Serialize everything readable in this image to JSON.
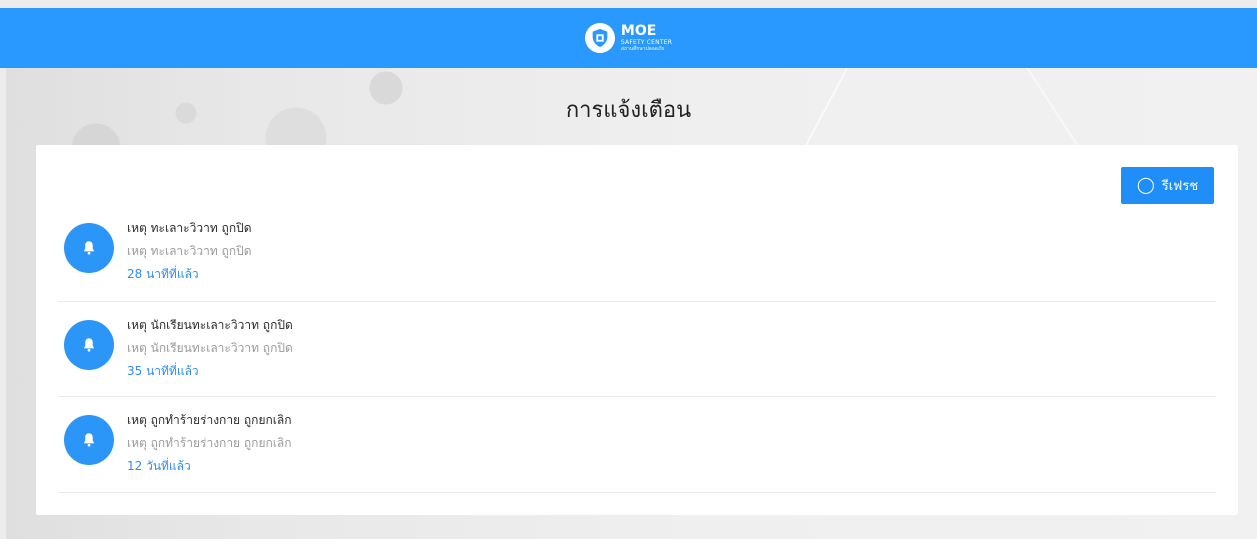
{
  "header": {
    "logo_title": "MOE",
    "logo_subtitle": "SAFETY CENTER",
    "logo_caption": "สถานศึกษาปลอดภัย"
  },
  "page": {
    "title": "การแจ้งเตือน"
  },
  "toolbar": {
    "refresh_label": "รีเฟรช"
  },
  "notifications": [
    {
      "title": "เหตุ ทะเลาะวิวาท ถูกปิด",
      "subtitle": "เหตุ ทะเลาะวิวาท ถูกปิด",
      "time": "28 นาทีที่แล้ว"
    },
    {
      "title": "เหตุ นักเรียนทะเลาะวิวาท ถูกปิด",
      "subtitle": "เหตุ นักเรียนทะเลาะวิวาท ถูกปิด",
      "time": "35 นาทีที่แล้ว"
    },
    {
      "title": "เหตุ ถูกทำร้ายร่างกาย ถูกยกเลิก",
      "subtitle": "เหตุ ถูกทำร้ายร่างกาย ถูกยกเลิก",
      "time": "12 วันที่แล้ว"
    }
  ],
  "colors": {
    "header": "#2a99ff",
    "accent": "#1f8ef8",
    "link": "#2f8df1"
  },
  "icons": {
    "logo": "shield-building-icon",
    "refresh": "refresh-icon",
    "notification": "bell-icon"
  }
}
